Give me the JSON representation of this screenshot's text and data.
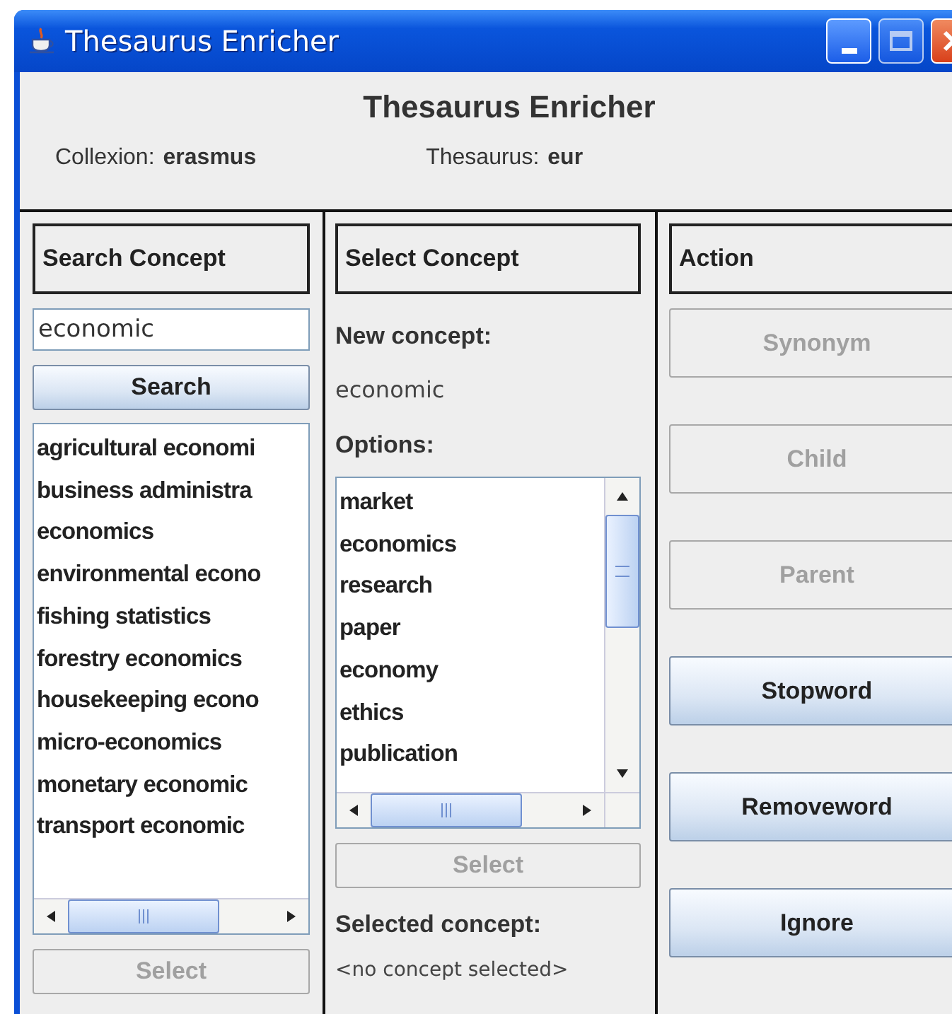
{
  "window": {
    "title": "Thesaurus Enricher"
  },
  "header": {
    "title": "Thesaurus Enricher",
    "fields": [
      {
        "label": "Collexion:",
        "value": "erasmus"
      },
      {
        "label": "Thesaurus:",
        "value": "eur"
      }
    ]
  },
  "search_panel": {
    "heading": "Search Concept",
    "query": "economic",
    "search_button": {
      "label": "Search",
      "disabled": false
    },
    "results": [
      {
        "label": "agricultural economi",
        "selected": false
      },
      {
        "label": "business administra",
        "selected": false
      },
      {
        "label": "economics",
        "selected": false
      },
      {
        "label": "environmental econo",
        "selected": false
      },
      {
        "label": "fishing statistics",
        "selected": false
      },
      {
        "label": "forestry economics",
        "selected": false
      },
      {
        "label": "housekeeping econo",
        "selected": false
      },
      {
        "label": "micro-economics",
        "selected": false
      },
      {
        "label": "monetary economic",
        "selected": false
      },
      {
        "label": "transport economic",
        "selected": false
      }
    ],
    "select_button": {
      "label": "Select",
      "disabled": true
    }
  },
  "select_panel": {
    "heading": "Select Concept",
    "new_concept_label": "New concept:",
    "new_concept": "economic",
    "options_label": "Options:",
    "options": [
      {
        "label": "market",
        "selected": false
      },
      {
        "label": "economics",
        "selected": false
      },
      {
        "label": "research",
        "selected": false
      },
      {
        "label": "paper",
        "selected": false
      },
      {
        "label": "economy",
        "selected": false
      },
      {
        "label": "ethics",
        "selected": false
      },
      {
        "label": "publication",
        "selected": false
      }
    ],
    "select_button": {
      "label": "Select",
      "disabled": true
    },
    "selected_label": "Selected concept:",
    "selected_value": "<no concept selected>"
  },
  "action_panel": {
    "heading": "Action",
    "buttons": [
      {
        "label": "Synonym",
        "disabled": true
      },
      {
        "label": "Child",
        "disabled": true
      },
      {
        "label": "Parent",
        "disabled": true
      },
      {
        "label": "Stopword",
        "disabled": false
      },
      {
        "label": "Removeword",
        "disabled": false
      },
      {
        "label": "Ignore",
        "disabled": false
      }
    ]
  }
}
